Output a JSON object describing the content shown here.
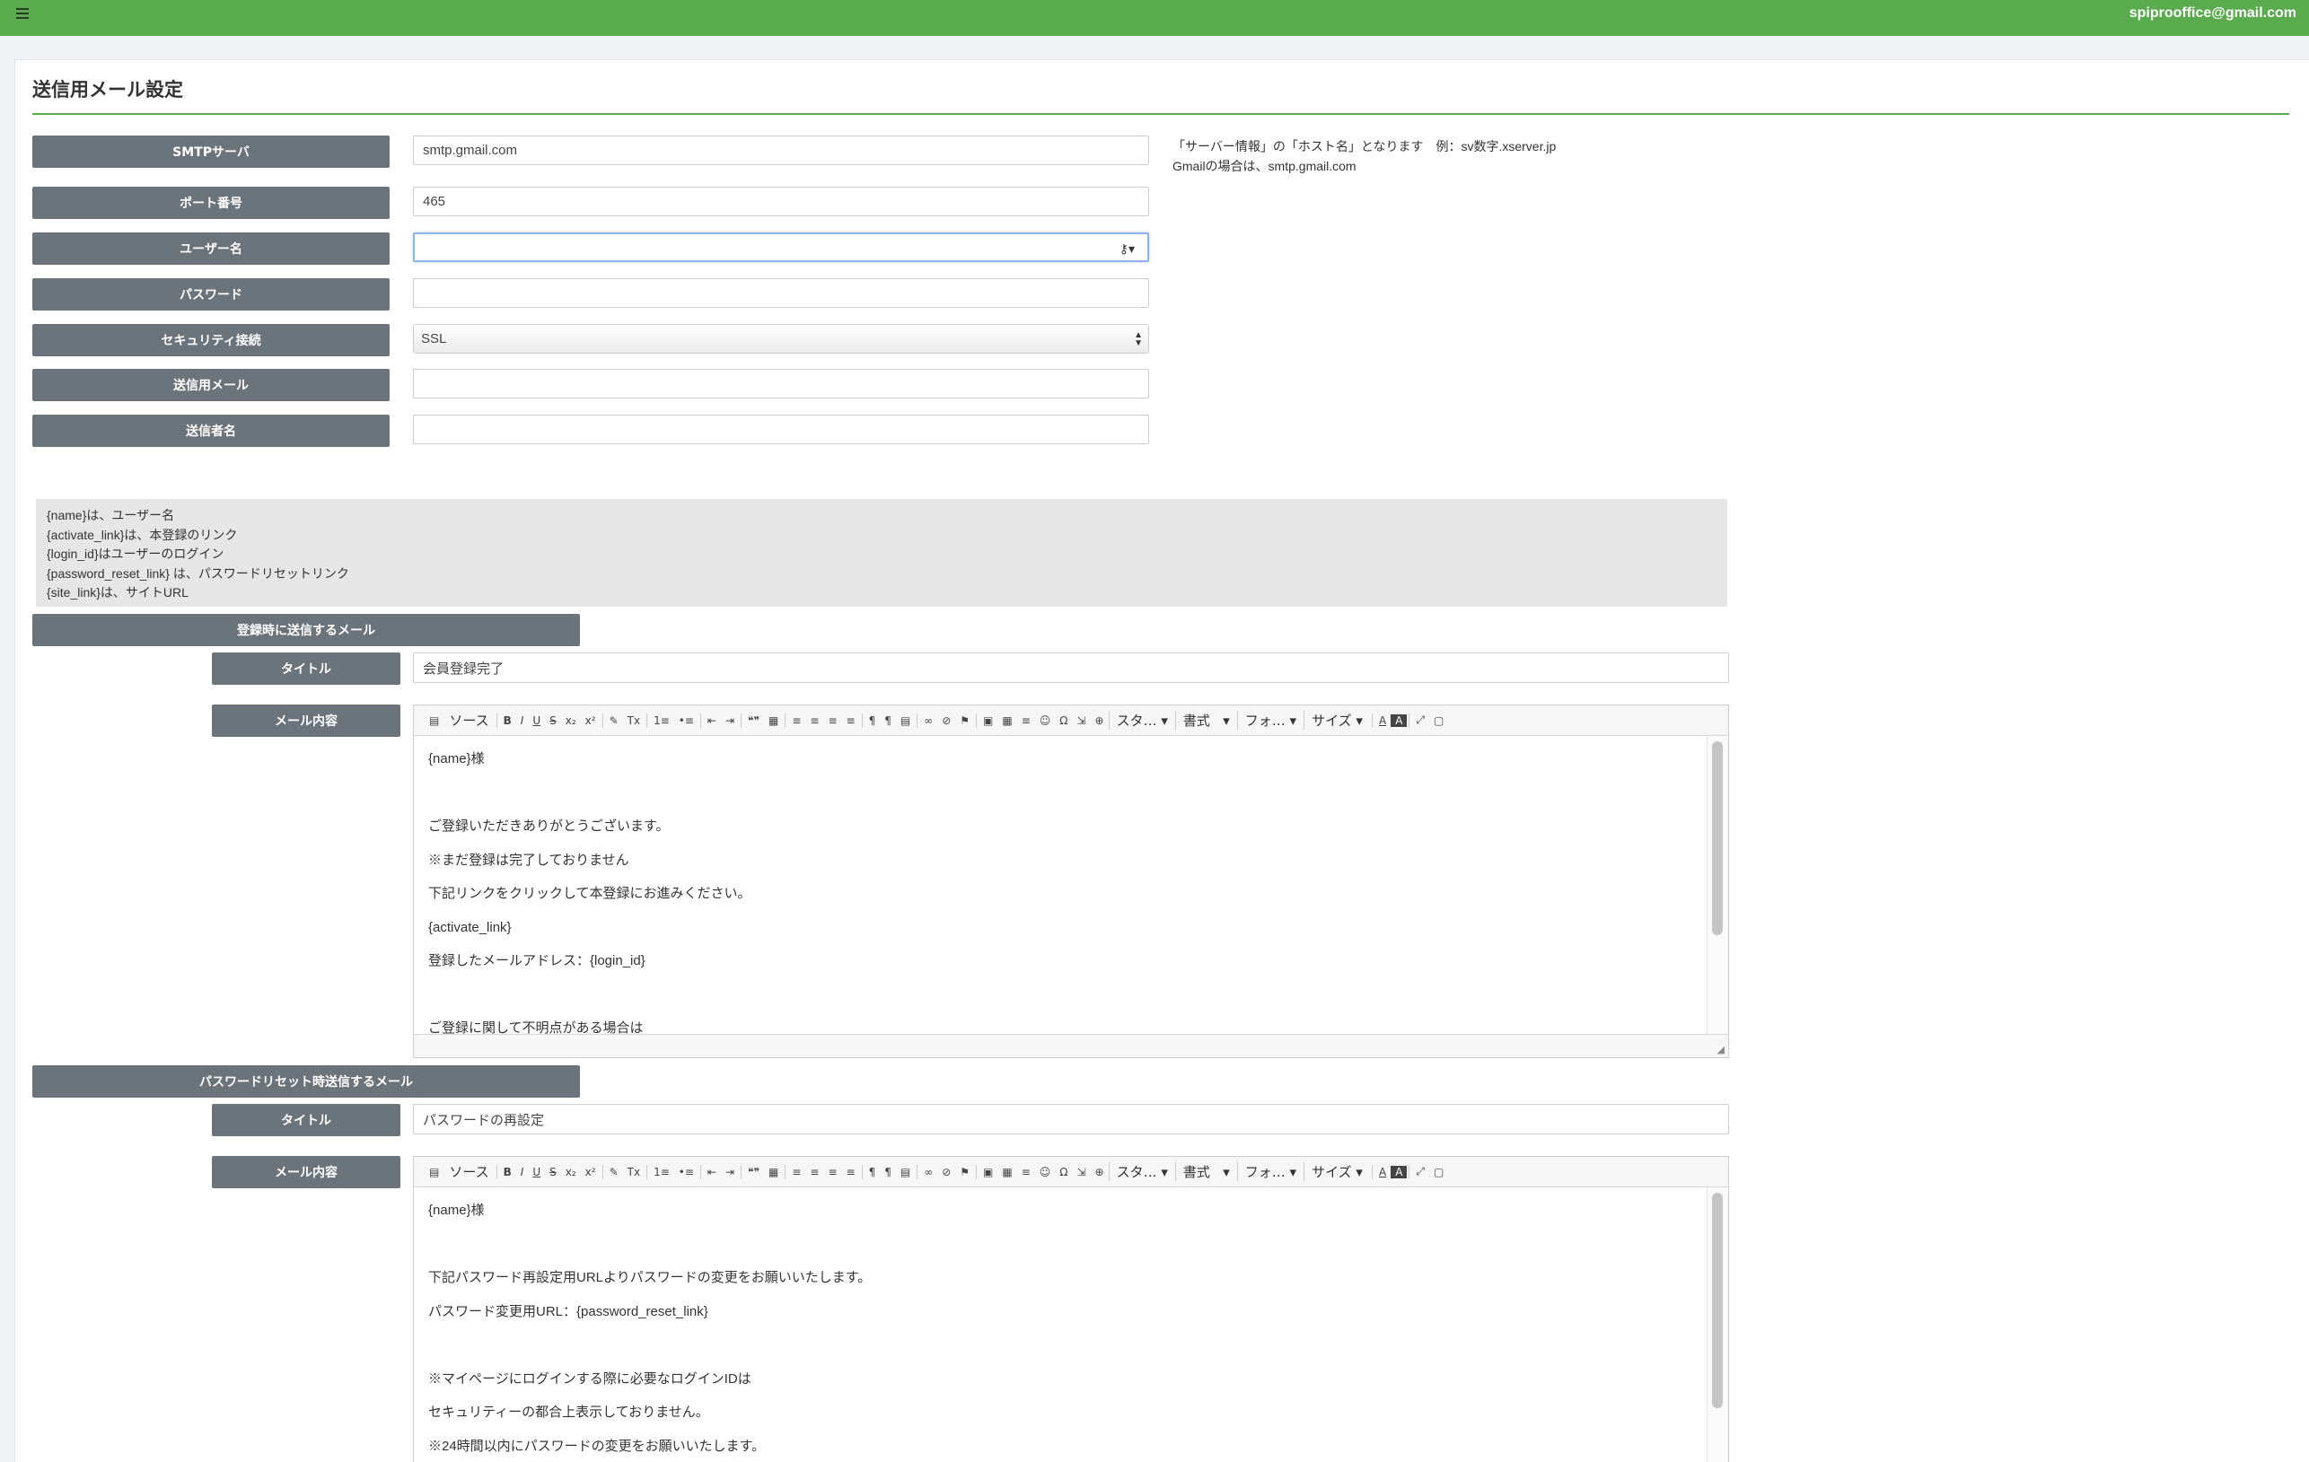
{
  "header": {
    "menu_icon": "hamburger-icon",
    "user_email": "spiprooffice@gmail.com",
    "bar_color": "#5aab4e"
  },
  "page": {
    "title": "送信用メール設定"
  },
  "smtp": {
    "server_label": "SMTPサーバ",
    "server_value": "smtp.gmail.com",
    "port_label": "ポート番号",
    "port_value": "465",
    "username_label": "ユーザー名",
    "username_value": "",
    "password_label": "パスワード",
    "password_value": "",
    "security_label": "セキュリティ接続",
    "security_value": "SSL",
    "sender_mail_label": "送信用メール",
    "sender_mail_value": "",
    "sender_name_label": "送信者名",
    "sender_name_value": "",
    "help_line1": "「サーバー情報」の「ホスト名」となります　例：sv数字.xserver.jp",
    "help_line2": "Gmailの場合は、smtp.gmail.com"
  },
  "variables": [
    "{name}は、ユーザー名",
    "{activate_link}は、本登録のリンク",
    "{login_id}はユーザーのログイン",
    "{password_reset_link} は、パスワードリセットリンク",
    "{site_link}は、サイトURL"
  ],
  "toolbar": {
    "source_label": "ソース",
    "style_label": "スタ…",
    "format_label": "書式",
    "font_label": "フォ…",
    "size_label": "サイズ",
    "buttons": [
      "B",
      "I",
      "U",
      "S",
      "x₂",
      "x²",
      "✎",
      "Tx",
      "1≡",
      "•≡",
      "⇤",
      "⇥",
      "❝❞",
      "▦",
      "≡",
      "≡",
      "≡",
      "≡",
      "¶",
      "¶",
      "▤",
      "∞",
      "⊘",
      "⚑",
      "▣",
      "▦",
      "≡",
      "☺",
      "Ω",
      "⇲",
      "⊕"
    ],
    "tail_buttons": [
      "A",
      "A",
      "⤢",
      "▢"
    ]
  },
  "registration_mail": {
    "section_label": "登録時に送信するメール",
    "title_label": "タイトル",
    "title_value": "会員登録完了",
    "body_label": "メール内容",
    "body_lines": [
      "{name}様",
      "",
      "ご登録いただきありがとうございます。",
      "※まだ登録は完了しておりません",
      "下記リンクをクリックして本登録にお進みください。",
      "{activate_link}",
      "登録したメールアドレス：{login_id}",
      "",
      "ご登録に関して不明点がある場合は"
    ]
  },
  "reset_mail": {
    "section_label": "パスワードリセット時送信するメール",
    "title_label": "タイトル",
    "title_value": "パスワードの再設定",
    "body_label": "メール内容",
    "body_lines": [
      "{name}様",
      "",
      "下記パスワード再設定用URLよりパスワードの変更をお願いいたします。",
      "パスワード変更用URL：{password_reset_link}",
      "",
      "※マイページにログインする際に必要なログインIDは",
      "セキュリティーの都合上表示しておりません。",
      "※24時間以内にパスワードの変更をお願いいたします。"
    ]
  }
}
